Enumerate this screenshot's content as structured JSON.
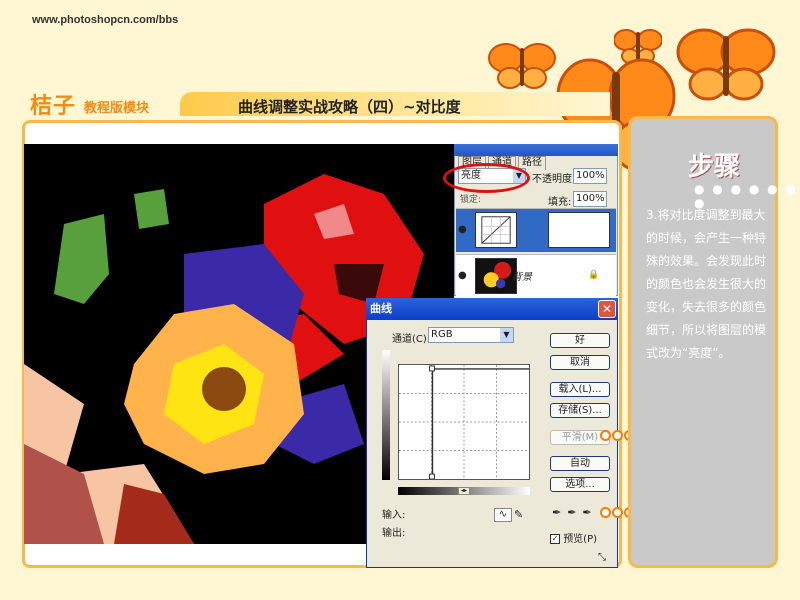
{
  "site_url": "www.photoshopcn.com/bbs",
  "brand": {
    "main": "桔子",
    "sub": "教程版模块"
  },
  "page_title": "曲线调整实战攻略（四）~对比度",
  "side_panel": {
    "heading": "步骤",
    "dots": "● ● ● ● ● ● ●",
    "text": "3.将对比度调整到最大的时候，会产生一种特殊的效果。会发现此时的颜色也会发生很大的变化，失去很多的颜色细节，所以将图层的模式改为“亮度”。"
  },
  "layers_panel": {
    "tabs": [
      "图层",
      "通道",
      "路径"
    ],
    "blend_mode": "亮度",
    "opacity_label": "不透明度:",
    "opacity_value": "100%",
    "lock_label": "锁定:",
    "fill_label": "填充:",
    "fill_value": "100%",
    "layers": [
      {
        "name": ""
      },
      {
        "name": "背景"
      }
    ]
  },
  "curves_dialog": {
    "title": "曲线",
    "channel_label": "通道(C):",
    "channel_value": "RGB",
    "input_label": "输入:",
    "output_label": "输出:",
    "buttons": {
      "ok": "好",
      "cancel": "取消",
      "load": "载入(L)...",
      "save": "存储(S)...",
      "smooth": "平滑(M)",
      "auto": "自动",
      "options": "选项..."
    },
    "preview_label": "预览(P)",
    "preview_checked": true
  },
  "colors": {
    "accent": "#f6b94a",
    "brand": "#f08c12",
    "highlight": "#e01010",
    "ring": "#ff7a00"
  },
  "icons": [
    "eye-icon",
    "lock-icon",
    "close-icon",
    "curve-tool-icon",
    "pencil-icon",
    "eyedropper-icon",
    "butterfly-icon"
  ]
}
